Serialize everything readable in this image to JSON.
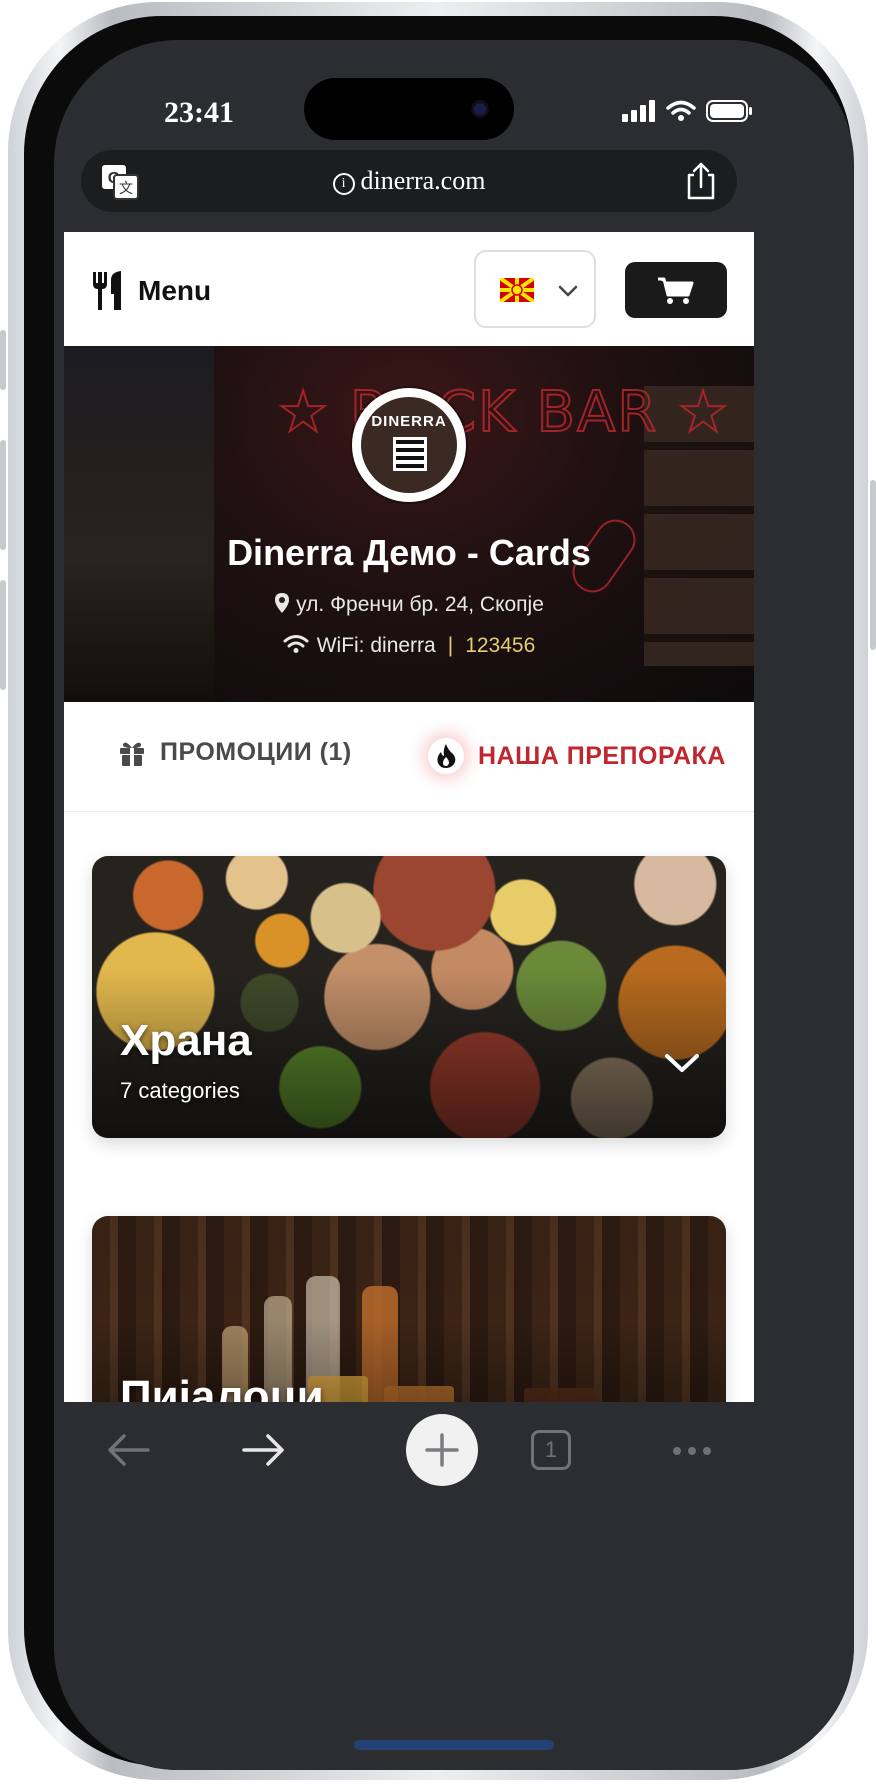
{
  "status_bar": {
    "time": "23:41"
  },
  "browser": {
    "url": "dinerra.com",
    "translate_icon": "translate-icon",
    "share_icon": "share-icon"
  },
  "nav": {
    "brand_label": "Menu",
    "brand_icon": "utensils-icon",
    "language_flag": "🇲🇰",
    "cart_icon": "cart-icon"
  },
  "hero": {
    "title": "Dinerra Демо - Cards",
    "address": "ул. Френчи бр. 24, Скопје",
    "wifi_label": "WiFi: dinerra",
    "wifi_separator": "|",
    "wifi_password": "123456",
    "logo_text": "DINERRA",
    "sign_text": "ROCK BAR"
  },
  "tabs": [
    {
      "label": "ПРОМОЦИИ (1)",
      "icon": "gift-icon"
    },
    {
      "label": "НАША ПРЕПОРАКА",
      "icon": "fire-icon"
    }
  ],
  "cards": [
    {
      "title": "Храна",
      "subtitle": "7 categories"
    },
    {
      "title": "Пијалоци"
    }
  ],
  "toolbar": {
    "tab_count": "1"
  },
  "colors": {
    "accent_red": "#c0262e",
    "wifi_password": "#e3cf6e",
    "toolbar_bg": "#2b2d30",
    "cart_button": "#1a1a1a"
  }
}
